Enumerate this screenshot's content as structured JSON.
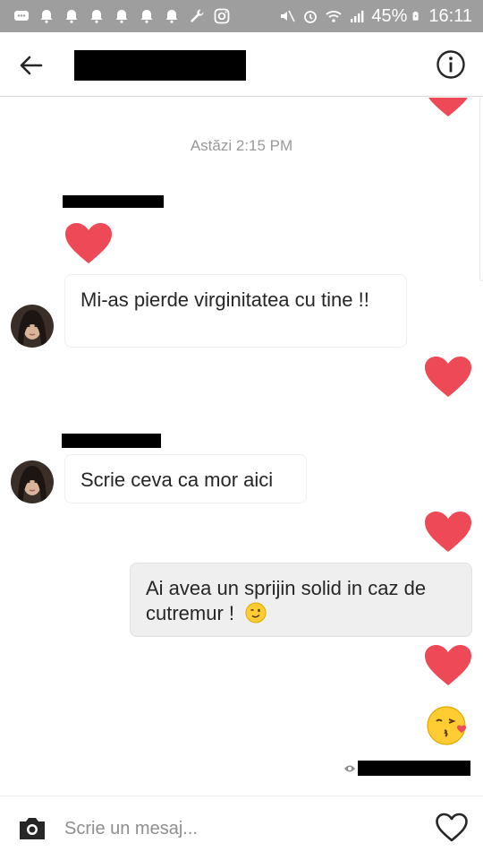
{
  "status_bar": {
    "battery_percent": "45%",
    "time": "16:11",
    "icons": [
      "chat-icon",
      "bell-icon",
      "bell-icon",
      "bell-icon",
      "bell-icon",
      "bell-icon",
      "bell-icon",
      "wrench-icon",
      "instagram-icon",
      "mute-icon",
      "alarm-icon",
      "wifi-icon",
      "signal-icon",
      "battery-charging-icon"
    ]
  },
  "header": {
    "back_icon": "arrow-left-icon",
    "info_icon": "info-icon"
  },
  "colors": {
    "heart": "#ED4956",
    "status_bar": "#9E9E9E",
    "mine_bubble": "#EFEFEF"
  },
  "conversation": {
    "timestamp": "Astăzi 2:15 PM",
    "messages": [
      {
        "sender": "them",
        "type": "heart"
      },
      {
        "sender": "them",
        "type": "text",
        "text": "Mi-as pierde virginitatea cu tine !!"
      },
      {
        "sender": "me",
        "type": "heart"
      },
      {
        "sender": "them",
        "type": "text",
        "text": "Scrie ceva ca mor aici"
      },
      {
        "sender": "me",
        "type": "heart"
      },
      {
        "sender": "me",
        "type": "text",
        "text": "Ai avea un sprijin solid in caz de cutremur !",
        "emoji": "winking-face-emoji"
      },
      {
        "sender": "me",
        "type": "heart"
      },
      {
        "sender": "me",
        "type": "emoji",
        "emoji": "face-blowing-kiss-emoji"
      }
    ]
  },
  "composer": {
    "placeholder": "Scrie un mesaj...",
    "camera_icon": "camera-icon",
    "like_icon": "heart-outline-icon"
  }
}
